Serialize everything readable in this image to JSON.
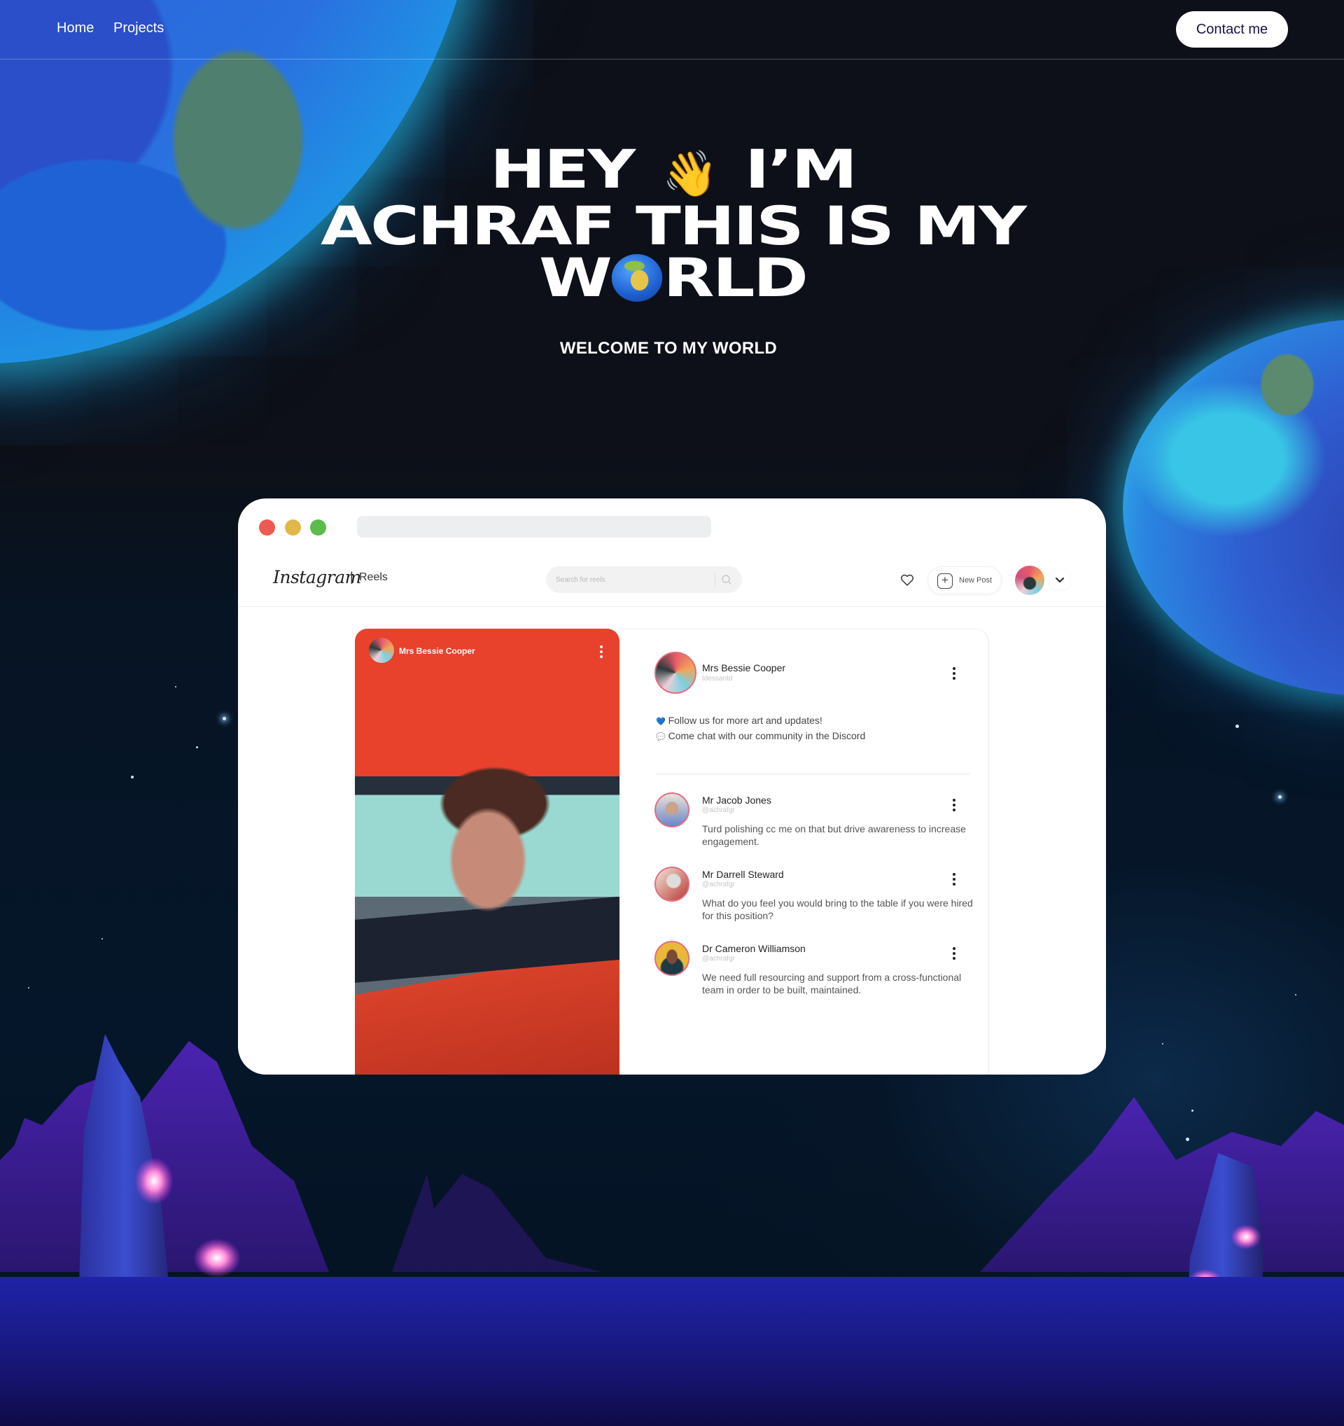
{
  "nav": {
    "links": [
      {
        "label": "Home"
      },
      {
        "label": "Projects"
      }
    ],
    "contact_label": "Contact me"
  },
  "hero": {
    "line1_a": "HEY",
    "line1_emoji": "👋",
    "line1_b": "I’M",
    "line2": "ACHRAF THIS IS MY",
    "line3_a": "W",
    "line3_b": "RLD",
    "globe_icon": "globe-europe-africa",
    "subtitle": "WELCOME TO MY WORLD"
  },
  "browser": {
    "traffic_lights": {
      "close": "#ec5a54",
      "minimize": "#e0b84a",
      "maximize": "#5cbb4a"
    },
    "instagram": {
      "logo": "Instagram",
      "separator": "|",
      "section": "Reels",
      "search_placeholder": "Search for reels",
      "new_post_label": "New Post"
    },
    "reel": {
      "author": "Mrs Bessie Cooper"
    },
    "post": {
      "author": "Mrs Bessie Cooper",
      "handle": "tdessantd",
      "caption_line1_icon": "💙",
      "caption_line1": "Follow us for more art and updates!",
      "caption_line2_icon": "💬",
      "caption_line2": "Come chat with our community in the Discord"
    },
    "comments": [
      {
        "name": "Mr Jacob Jones",
        "handle": "@achrafgr",
        "text": "Turd polishing cc me on that but drive awareness to increase engagement."
      },
      {
        "name": "Mr Darrell Steward",
        "handle": "@achrafgr",
        "text": "What do you feel you would bring to the table if you were hired for this position?"
      },
      {
        "name": "Dr Cameron Williamson",
        "handle": "@achrafgr",
        "text": "We need full resourcing and support from a cross-functional team in order to be built, maintained."
      }
    ]
  },
  "colors": {
    "background": "#0d1018",
    "contact_text": "#1b1147",
    "avatar_ring": "#e56b80"
  }
}
